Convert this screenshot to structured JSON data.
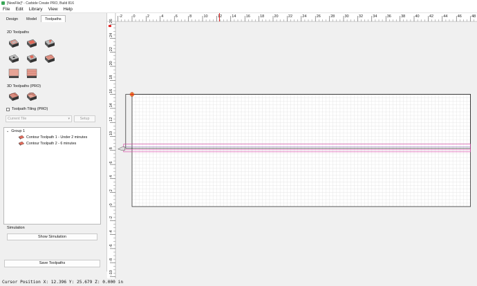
{
  "window": {
    "title": "[NewFile]* - Carbide Create PRO, Build 816"
  },
  "menubar": [
    "File",
    "Edit",
    "Library",
    "View",
    "Help"
  ],
  "tabs": [
    {
      "label": "Design",
      "active": false
    },
    {
      "label": "Model",
      "active": false
    },
    {
      "label": "Toolpaths",
      "active": true
    }
  ],
  "toolpaths_2d": {
    "label": "2D Toolpaths",
    "tools": [
      "contour-toolpath-icon",
      "pocket-toolpath-icon",
      "vcarve-toolpath-icon",
      "drill-toolpath-icon",
      "advanced-vcarve-toolpath-icon",
      "texture-toolpath-icon",
      "flat-pocket-toolpath-icon",
      "chamfer-toolpath-icon"
    ]
  },
  "toolpaths_3d": {
    "label": "3D Toolpaths (PRO)",
    "tools": [
      "3d-rough-toolpath-icon",
      "3d-finish-toolpath-icon"
    ]
  },
  "tiling": {
    "checkbox_label": "Toolpath Tiling (PRO)",
    "checked": false,
    "select_value": "Current Tile",
    "setup_label": "Setup"
  },
  "tree": {
    "group": "Group 1",
    "items": [
      "Contour Toolpath 1 - Under 2 minutes",
      "Contour Toolpath 2 - 6 minutes"
    ]
  },
  "simulation": {
    "label": "Simulation",
    "show_button": "Show Simulation"
  },
  "save_button": "Save Toolpaths",
  "status": {
    "cursor_text": "Cursor Position X: 12.396 Y: 25.679 Z: 0.000 in"
  },
  "ruler": {
    "x_labels": [
      "-2",
      "0",
      "2",
      "4",
      "6",
      "8",
      "10",
      "12",
      "14",
      "16",
      "18",
      "20",
      "22",
      "24",
      "26",
      "28",
      "30",
      "32",
      "34",
      "36",
      "38",
      "40",
      "42",
      "44",
      "46",
      "48"
    ],
    "y_labels": [
      "26",
      "24",
      "22",
      "20",
      "18",
      "16",
      "14",
      "12",
      "10",
      "8",
      "6",
      "4",
      "2",
      "0",
      "-2",
      "-4",
      "-6",
      "-8",
      "-10"
    ],
    "cursor_x": 12.396
  },
  "colors": {
    "accent_red": "#e02020",
    "toolpath_pink": "#d94ba8",
    "stock_border": "#333333",
    "grid": "#dcdcdc"
  }
}
